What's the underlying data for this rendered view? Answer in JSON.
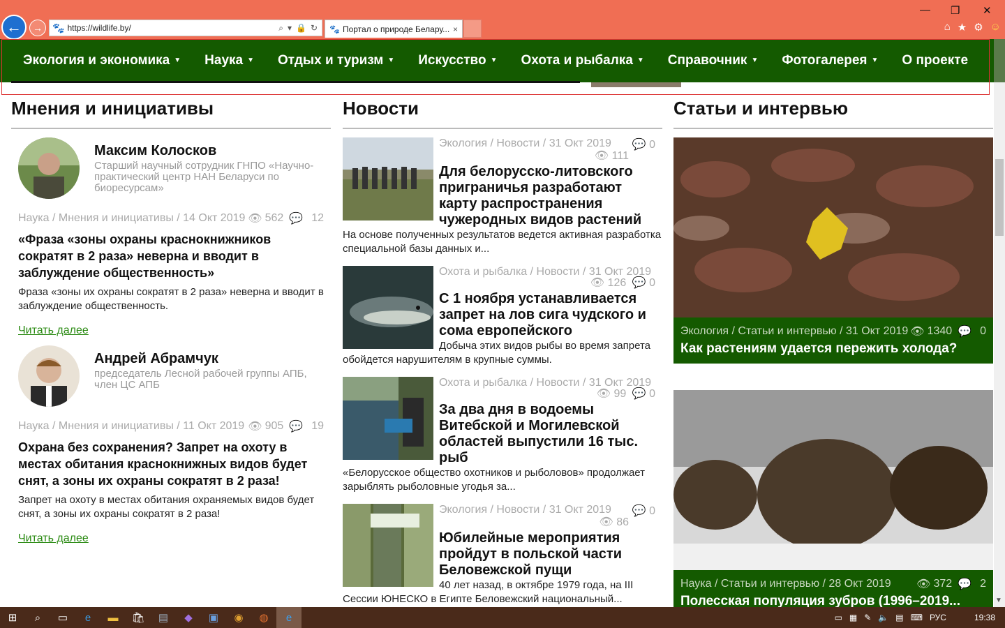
{
  "browser": {
    "url": "https://wildlife.by/",
    "tab_title": "Портал о природе Белару...",
    "tab_close": "×",
    "win_minimize": "—",
    "win_restore": "❐",
    "win_close": "✕"
  },
  "nav": {
    "items": [
      "Экология и экономика",
      "Наука",
      "Отдых и туризм",
      "Искусство",
      "Охота и рыбалка",
      "Справочник",
      "Фотогалерея",
      "О проекте"
    ]
  },
  "opinions": {
    "heading": "Мнения и инициативы",
    "items": [
      {
        "name": "Максим Колосков",
        "role": "Старший научный сотрудник ГНПО «Научно-практический центр НАН Беларуси по биоресурсам»",
        "meta": "Наука / Мнения и инициативы / 14 Окт 2019",
        "views": "562",
        "comments": "12",
        "title": "«Фраза «зоны охраны краснокнижников сократят в 2 раза» неверна и вводит в заблуждение общественность»",
        "desc": "Фраза «зоны их охраны сократят в 2 раза» неверна и вводит в заблуждение общественность.",
        "readmore": "Читать далее"
      },
      {
        "name": "Андрей Абрамчук",
        "role": "председатель Лесной рабочей группы АПБ, член ЦС АПБ",
        "meta": "Наука / Мнения и инициативы / 11 Окт 2019",
        "views": "905",
        "comments": "19",
        "title": "Охрана без сохранения? Запрет на охоту в местах обитания краснокнижных видов будет снят, а зоны их охраны сократят в 2 раза!",
        "desc": "Запрет на охоту в местах обитания охраняемых видов будет снят, а зоны их охраны сократят в 2 раза!",
        "readmore": "Читать далее"
      }
    ]
  },
  "news": {
    "heading": "Новости",
    "items": [
      {
        "meta": "Экология / Новости / 31 Окт 2019",
        "comments": "0",
        "views": "111",
        "title": "Для белорусско-литовского приграничья разработают карту распространения чужеродных видов растений",
        "desc": "На основе полученных результатов ведется активная разработка специальной базы данных и..."
      },
      {
        "meta": "Охота и рыбалка / Новости / 31 Окт 2019",
        "comments": "0",
        "views": "126",
        "title": "С 1 ноября устанавливается запрет на лов сига чудского и сома европейского",
        "desc": "Добыча этих видов рыбы во время запрета обойдется нарушителям в крупные суммы."
      },
      {
        "meta": "Охота и рыбалка / Новости / 31 Окт 2019",
        "comments": "0",
        "views": "99",
        "title": "За два дня в водоемы Витебской и Могилевской областей выпустили 16 тыс. рыб",
        "desc": "«Белорусское общество охотников и рыболовов» продолжает зарыблять рыболовные угодья за..."
      },
      {
        "meta": "Экология / Новости / 31 Окт 2019",
        "comments": "0",
        "views": "86",
        "title": "Юбилейные мероприятия пройдут в польской части Беловежской пущи",
        "desc": "40 лет назад, в октябре 1979 года, на III Сессии ЮНЕСКО в Египте Беловежский национальный..."
      }
    ]
  },
  "articles": {
    "heading": "Статьи и интервью",
    "items": [
      {
        "meta": "Экология / Статьи и интервью / 31 Окт 2019",
        "views": "1340",
        "comments": "0",
        "title": "Как растениям удается пережить холода?"
      },
      {
        "meta": "Наука / Статьи и интервью / 28 Окт 2019",
        "views": "372",
        "comments": "2",
        "title": "Полесская популяция зубров (1996–2019..."
      }
    ]
  },
  "taskbar": {
    "lang": "РУС",
    "time": "19:38"
  },
  "colors": {
    "chrome": "#f06e54",
    "nav": "#145a00",
    "link": "#2a8a12"
  }
}
